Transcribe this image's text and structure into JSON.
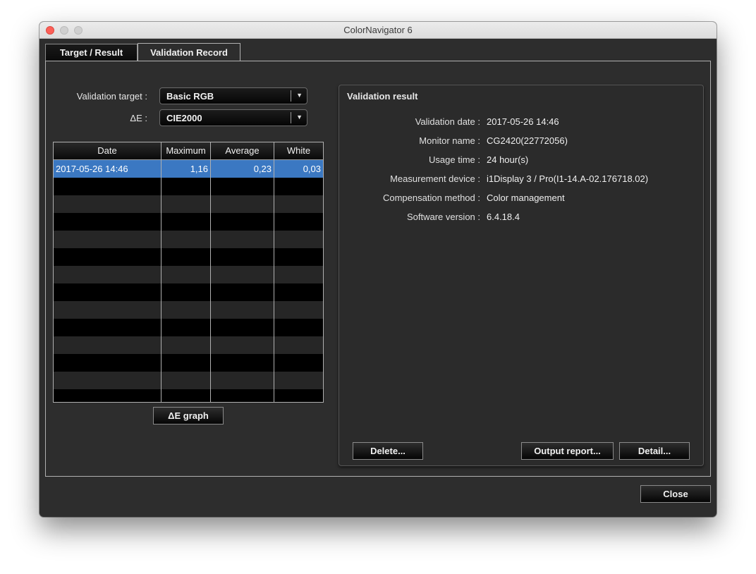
{
  "window": {
    "title": "ColorNavigator 6"
  },
  "tabs": [
    {
      "label": "Target / Result",
      "active": false
    },
    {
      "label": "Validation Record",
      "active": true
    }
  ],
  "filters": {
    "target_label": "Validation target :",
    "target_value": "Basic RGB",
    "delta_label": "ΔE :",
    "delta_value": "CIE2000"
  },
  "table": {
    "columns": [
      "Date",
      "Maximum",
      "Average",
      "White"
    ],
    "rows": [
      {
        "date": "2017-05-26 14:46",
        "maximum": "1,16",
        "average": "0,23",
        "white": "0,03",
        "selected": true
      }
    ]
  },
  "buttons": {
    "delta_graph": "ΔE graph",
    "delete": "Delete...",
    "output_report": "Output report...",
    "detail": "Detail...",
    "close": "Close"
  },
  "result": {
    "title": "Validation result",
    "fields": [
      {
        "key": "Validation date :",
        "value": "2017-05-26 14:46"
      },
      {
        "key": "Monitor name :",
        "value": "CG2420(22772056)"
      },
      {
        "key": "Usage time :",
        "value": "24 hour(s)"
      },
      {
        "key": "Measurement device :",
        "value": "i1Display 3 / Pro(I1-14.A-02.176718.02)"
      },
      {
        "key": "Compensation method :",
        "value": "Color management"
      },
      {
        "key": "Software version :",
        "value": "6.4.18.4"
      }
    ]
  },
  "colors": {
    "selection": "#3b78c2",
    "window_bg": "#2d2d2d",
    "close_light": "#fc5f57"
  }
}
